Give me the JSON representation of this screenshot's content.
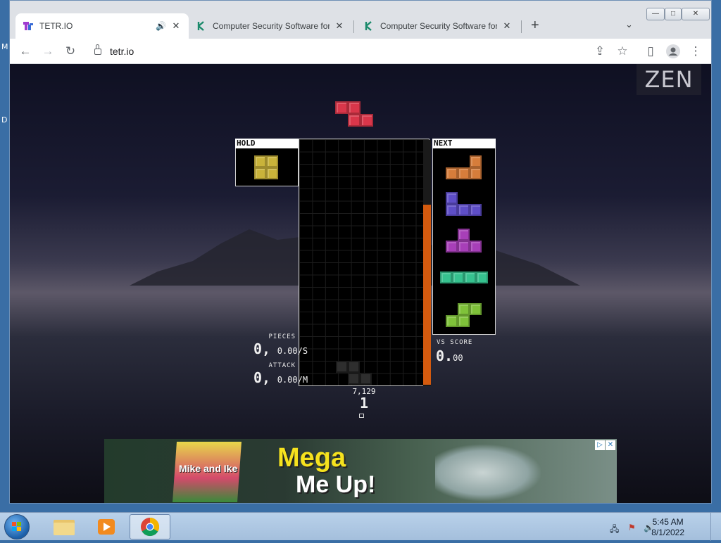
{
  "desktop": {
    "edge_letters": [
      "M",
      "D"
    ]
  },
  "window": {
    "controls": {
      "minimize": "—",
      "maximize": "□",
      "close": "✕"
    },
    "tabs": [
      {
        "title": "TETR.IO",
        "audio": "🔊",
        "close": "✕",
        "active": true
      },
      {
        "title": "Computer Security Software for Home",
        "close": "✕",
        "active": false
      },
      {
        "title": "Computer Security Software for Home",
        "close": "✕",
        "active": false
      }
    ],
    "new_tab": "+",
    "tab_search": "⌄"
  },
  "toolbar": {
    "back": "←",
    "forward": "→",
    "reload": "↻",
    "url": "tetr.io",
    "share": "⇪",
    "bookmark": "☆",
    "sidebar": "▯",
    "menu": "⋮"
  },
  "game": {
    "mode": "ZEN",
    "hold_label": "HOLD",
    "next_label": "NEXT",
    "pieces_label": "PIECES",
    "pieces_count": "0,",
    "pieces_rate": "0.00/S",
    "attack_label": "ATTACK",
    "attack_count": "0,",
    "attack_rate": "0.00/M",
    "vs_label": "VS SCORE",
    "vs_score_int": "0.",
    "vs_score_dec": "00",
    "score": "7,129",
    "level": "1",
    "hold_piece": "O",
    "current_piece": "Z",
    "next_queue": [
      "L",
      "J",
      "T",
      "I",
      "S"
    ],
    "garbage_meter_fraction": 0.73,
    "colors": {
      "Z": "#d9364a",
      "O": "#c9b33a",
      "L": "#d67d3b",
      "J": "#5e4ec7",
      "T": "#a73fb8",
      "I": "#36c28f",
      "S": "#7fc23a",
      "ghost": "#2e2e2e",
      "garbage": "#d45a0e"
    }
  },
  "ad": {
    "line1": "Mega",
    "line2": "Me Up!",
    "brand": "Mike and Ike",
    "adchoices": "▷",
    "close": "✕"
  },
  "taskbar": {
    "time": "5:45 AM",
    "date": "8/1/2022",
    "apps": [
      "file-explorer",
      "media-player",
      "chrome"
    ]
  }
}
